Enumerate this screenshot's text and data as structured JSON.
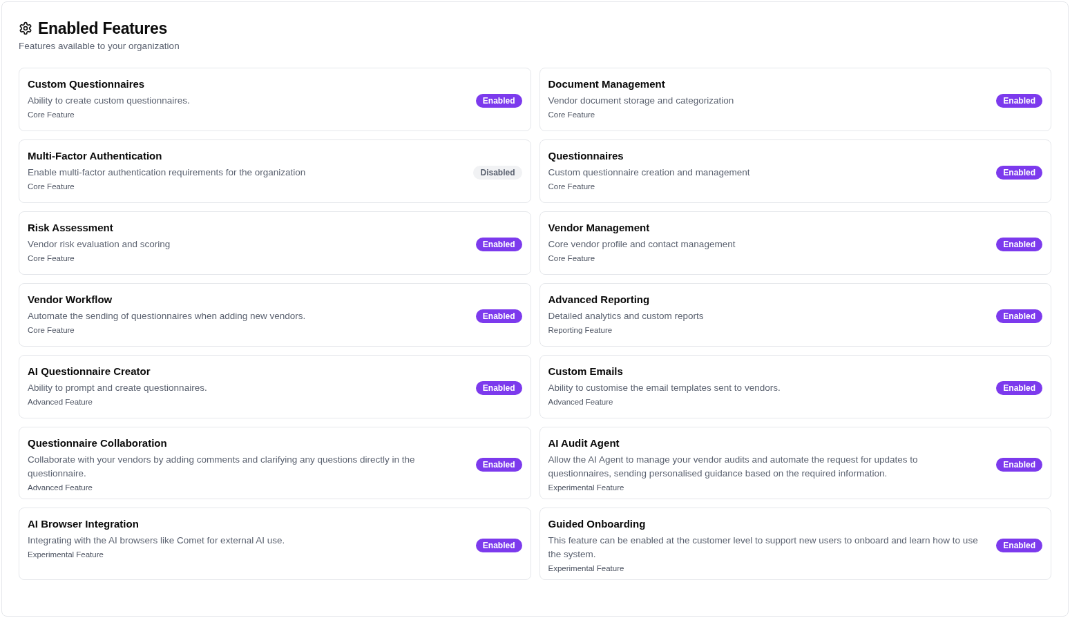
{
  "header": {
    "title": "Enabled Features",
    "subtitle": "Features available to your organization"
  },
  "features": [
    {
      "name": "Custom Questionnaires",
      "description": "Ability to create custom questionnaires.",
      "category": "Core Feature",
      "status": "Enabled",
      "enabled": true
    },
    {
      "name": "Document Management",
      "description": "Vendor document storage and categorization",
      "category": "Core Feature",
      "status": "Enabled",
      "enabled": true
    },
    {
      "name": "Multi-Factor Authentication",
      "description": "Enable multi-factor authentication requirements for the organization",
      "category": "Core Feature",
      "status": "Disabled",
      "enabled": false
    },
    {
      "name": "Questionnaires",
      "description": "Custom questionnaire creation and management",
      "category": "Core Feature",
      "status": "Enabled",
      "enabled": true
    },
    {
      "name": "Risk Assessment",
      "description": "Vendor risk evaluation and scoring",
      "category": "Core Feature",
      "status": "Enabled",
      "enabled": true
    },
    {
      "name": "Vendor Management",
      "description": "Core vendor profile and contact management",
      "category": "Core Feature",
      "status": "Enabled",
      "enabled": true
    },
    {
      "name": "Vendor Workflow",
      "description": "Automate the sending of questionnaires when adding new vendors.",
      "category": "Core Feature",
      "status": "Enabled",
      "enabled": true
    },
    {
      "name": "Advanced Reporting",
      "description": "Detailed analytics and custom reports",
      "category": "Reporting Feature",
      "status": "Enabled",
      "enabled": true
    },
    {
      "name": "AI Questionnaire Creator",
      "description": "Ability to prompt and create questionnaires.",
      "category": "Advanced Feature",
      "status": "Enabled",
      "enabled": true
    },
    {
      "name": "Custom Emails",
      "description": "Ability to customise the email templates sent to vendors.",
      "category": "Advanced Feature",
      "status": "Enabled",
      "enabled": true
    },
    {
      "name": "Questionnaire Collaboration",
      "description": "Collaborate with your vendors by adding comments and clarifying any questions directly in the questionnaire.",
      "category": "Advanced Feature",
      "status": "Enabled",
      "enabled": true
    },
    {
      "name": "AI Audit Agent",
      "description": "Allow the AI Agent to manage your vendor audits and automate the request for updates to questionnaires, sending personalised guidance based on the required information.",
      "category": "Experimental Feature",
      "status": "Enabled",
      "enabled": true
    },
    {
      "name": "AI Browser Integration",
      "description": "Integrating with the AI browsers like Comet for external AI use.",
      "category": "Experimental Feature",
      "status": "Enabled",
      "enabled": true
    },
    {
      "name": "Guided Onboarding",
      "description": "This feature can be enabled at the customer level to support new users to onboard and learn how to use the system.",
      "category": "Experimental Feature",
      "status": "Enabled",
      "enabled": true
    }
  ]
}
